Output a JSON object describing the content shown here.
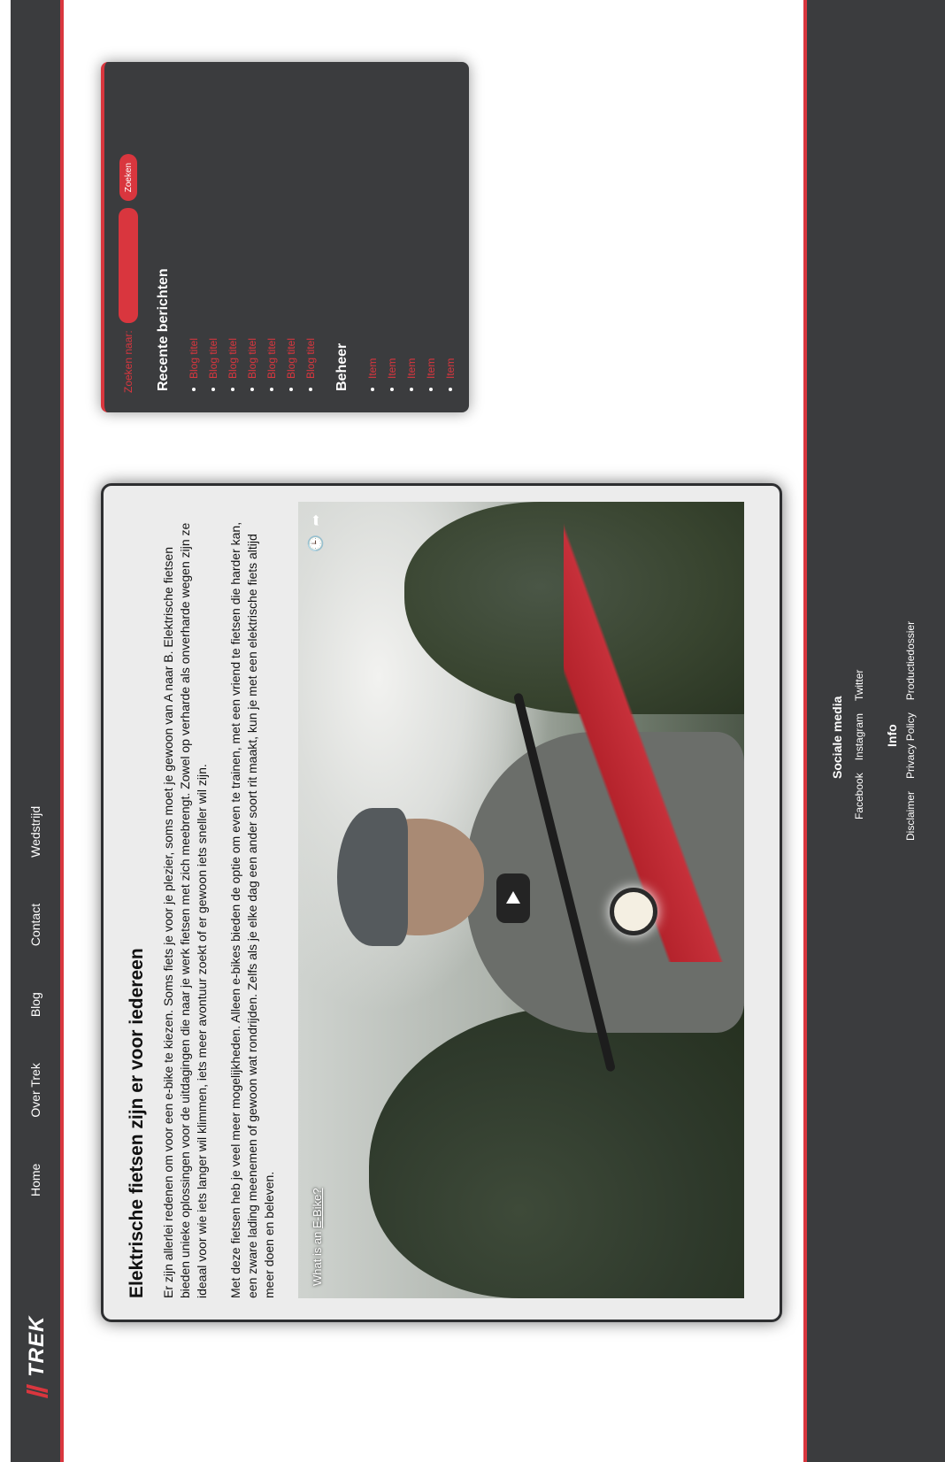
{
  "header": {
    "brand": "TREK",
    "nav": [
      "Home",
      "Over Trek",
      "Blog",
      "Contact",
      "Wedstrijd"
    ]
  },
  "article": {
    "title": "Elektrische fietsen zijn er voor iedereen",
    "paragraph1": "Er zijn allerlei redenen om voor een e-bike te kiezen. Soms fiets je voor je plezier, soms moet je gewoon van A naar B. Elektrische fietsen bieden unieke oplossingen voor de uitdagingen die naar je werk fietsen met zich meebrengt. Zowel op verharde als onverharde wegen zijn ze ideaal voor wie iets langer wil klimmen, iets meer avontuur zoekt of er gewoon iets sneller wil zijn.",
    "paragraph2": "Met deze fietsen heb je veel meer mogelijkheden. Alleen e-bikes bieden de optie om even te trainen, met een vriend te fietsen die harder kan, een zware lading meenemen of gewoon wat rondrijden. Zelfs als je elke dag een ander soort rit maakt, kun je met een elektrische fiets altijd meer doen en beleven.",
    "video": {
      "title_prefix": "What is an ",
      "title_link": "E-Bike?"
    }
  },
  "sidebar": {
    "search_label": "Zoeken naar:",
    "search_value": "",
    "search_button": "Zoeken",
    "recent_heading": "Recente berichten",
    "recent_items": [
      "Blog titel",
      "Blog titel",
      "Blog titel",
      "Blog titel",
      "Blog titel",
      "Blog titel",
      "Blog titel"
    ],
    "beheer_heading": "Beheer",
    "beheer_items": [
      "Item",
      "Item",
      "Item",
      "Item",
      "Item"
    ]
  },
  "footer": {
    "social_heading": "Sociale media",
    "social_links": [
      "Facebook",
      "Instagram",
      "Twitter"
    ],
    "info_heading": "Info",
    "info_links": [
      "Disclaimer",
      "Privacy Policy",
      "Productiedossier"
    ]
  },
  "colors": {
    "accent": "#d9363e",
    "dark": "#3b3c3e",
    "card_bg": "#ececec"
  }
}
